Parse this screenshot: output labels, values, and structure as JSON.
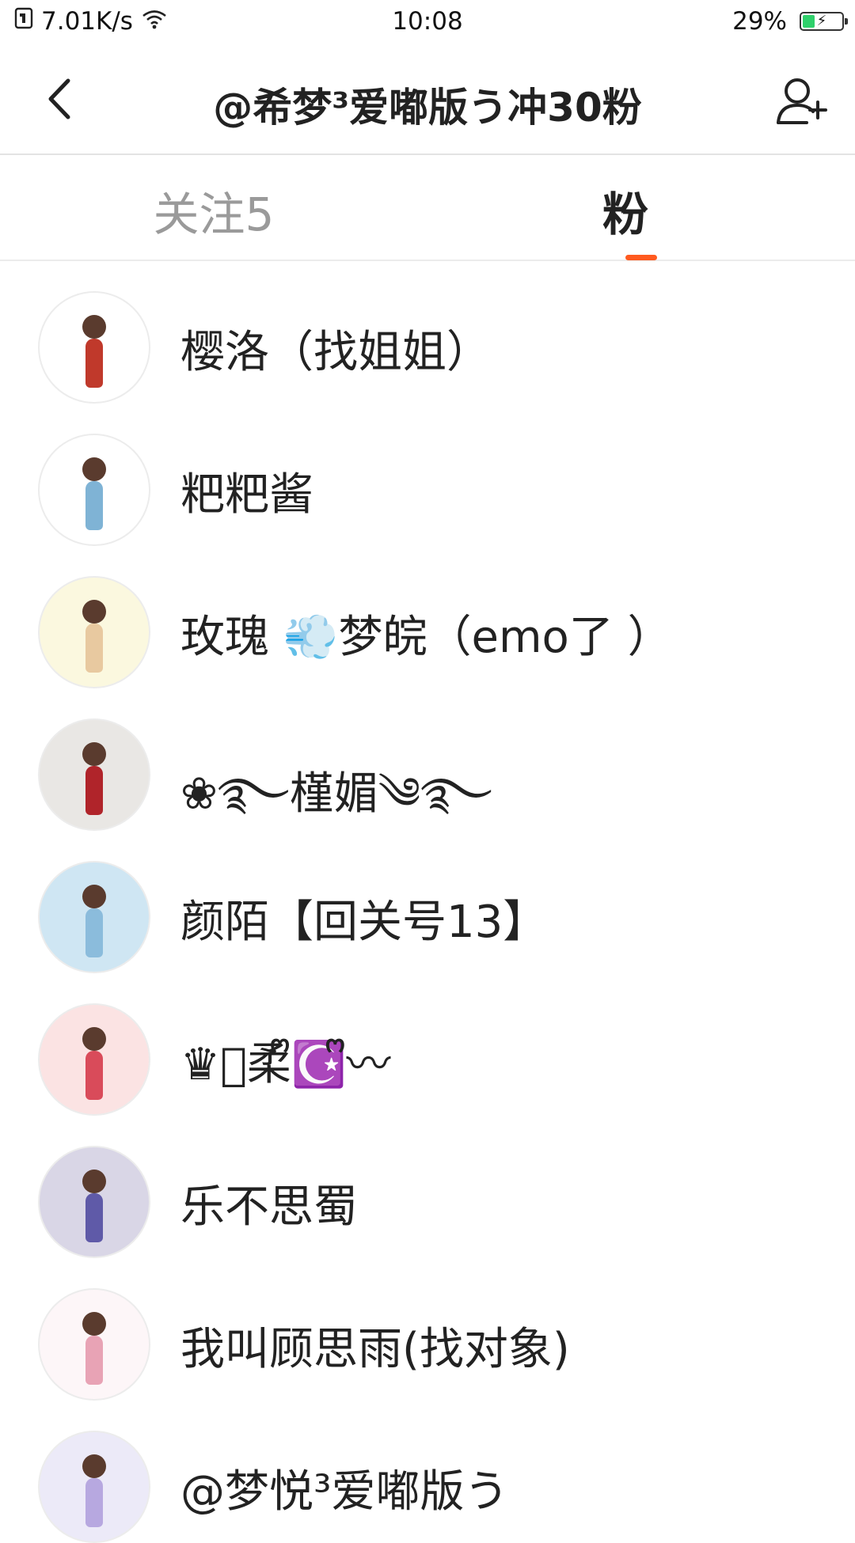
{
  "status_bar": {
    "net_speed": "7.01K/s",
    "time": "10:08",
    "battery_percent": "29%",
    "battery_level": 0.29,
    "battery_color": "#2fd06b",
    "icons": [
      "sim-icon",
      "wifi-icon",
      "battery-charging-icon"
    ]
  },
  "header": {
    "title": "@希梦³爱嘟版う冲30粉",
    "back_icon": "chevron-left-icon",
    "add_user_icon": "add-user-icon"
  },
  "tabs": [
    {
      "label": "关注5",
      "active": false
    },
    {
      "label": "粉",
      "active": true
    }
  ],
  "accent_color": "#ff5a1f",
  "fans": [
    {
      "name": "樱洛（找姐姐）",
      "avatar_bg": "#ffffff",
      "avatar_accent": "#c0392b"
    },
    {
      "name": "粑粑酱",
      "avatar_bg": "#ffffff",
      "avatar_accent": "#7fb3d5"
    },
    {
      "name": "玫瑰 💨梦皖（emo了 ）",
      "avatar_bg": "#fbf8df",
      "avatar_accent": "#e8c9a0"
    },
    {
      "name": "❀࿐槿媚༄࿐",
      "avatar_bg": "#e9e7e4",
      "avatar_accent": "#b0242a"
    },
    {
      "name": "颜陌【回关号13】",
      "avatar_bg": "#cfe6f3",
      "avatar_accent": "#8bbcdc"
    },
    {
      "name": "♛ᩚ柔ᩚ☪️ᩚ〰",
      "avatar_bg": "#fbe3e3",
      "avatar_accent": "#d94b5a"
    },
    {
      "name": "乐不思蜀",
      "avatar_bg": "#d9d6e6",
      "avatar_accent": "#5f5aa8"
    },
    {
      "name": "我叫顾思雨(找对象)",
      "avatar_bg": "#fdf6f8",
      "avatar_accent": "#e8a3b5"
    },
    {
      "name": "@梦悦³爱嘟版う",
      "avatar_bg": "#eceaf8",
      "avatar_accent": "#b7a8e0"
    }
  ]
}
